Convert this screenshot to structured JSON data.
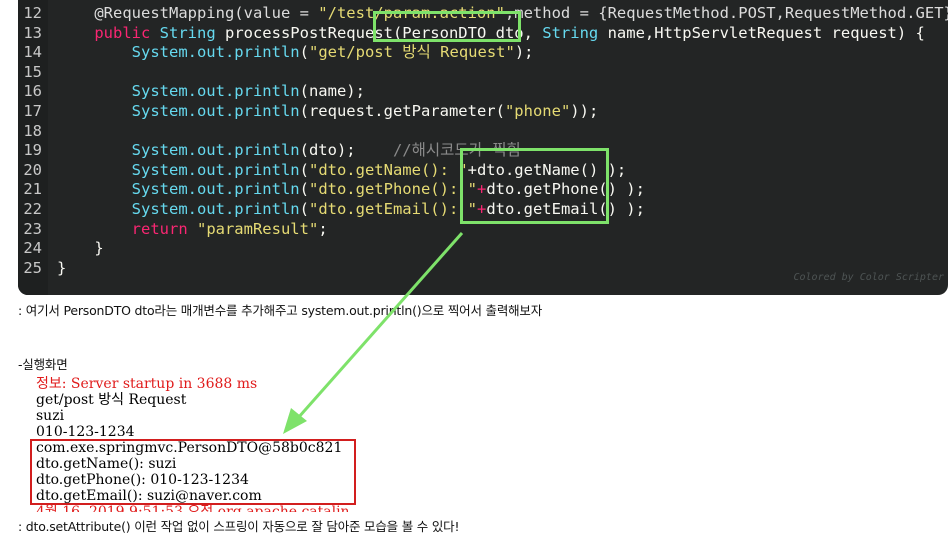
{
  "code": {
    "lines": [
      {
        "n": "12",
        "tokens": [
          [
            "ann",
            "    @RequestMapping(value = "
          ],
          [
            "str",
            "\"/test/param.action\""
          ],
          [
            "ann",
            ",method = {RequestMethod.POST,RequestMethod.GET})"
          ]
        ]
      },
      {
        "n": "13",
        "tokens": [
          [
            "kw",
            "    public "
          ],
          [
            "type",
            "String "
          ],
          [
            "plain",
            "processPostRequest(PersonDTO dto, "
          ],
          [
            "type",
            "String "
          ],
          [
            "plain",
            "name,HttpServletRequest request) {"
          ]
        ]
      },
      {
        "n": "14",
        "tokens": [
          [
            "sys",
            "        System.out.println"
          ],
          [
            "plain",
            "("
          ],
          [
            "str",
            "\"get/post 방식 Request\""
          ],
          [
            "plain",
            ");"
          ]
        ]
      },
      {
        "n": "15",
        "tokens": [
          [
            "plain",
            ""
          ]
        ]
      },
      {
        "n": "16",
        "tokens": [
          [
            "sys",
            "        System.out.println"
          ],
          [
            "plain",
            "(name);"
          ]
        ]
      },
      {
        "n": "17",
        "tokens": [
          [
            "sys",
            "        System.out.println"
          ],
          [
            "plain",
            "(request.getParameter("
          ],
          [
            "str",
            "\"phone\""
          ],
          [
            "plain",
            "));"
          ]
        ]
      },
      {
        "n": "18",
        "tokens": [
          [
            "plain",
            ""
          ]
        ]
      },
      {
        "n": "19",
        "tokens": [
          [
            "sys",
            "        System.out.println"
          ],
          [
            "plain",
            "(dto);    "
          ],
          [
            "cmt",
            "//해시코드가 찍힘"
          ]
        ]
      },
      {
        "n": "20",
        "tokens": [
          [
            "sys",
            "        System.out.println"
          ],
          [
            "plain",
            "("
          ],
          [
            "str",
            "\"dto.getName(): \""
          ],
          [
            "plain",
            "+dto.getName() );"
          ]
        ]
      },
      {
        "n": "21",
        "tokens": [
          [
            "sys",
            "        System.out.println"
          ],
          [
            "plain",
            "("
          ],
          [
            "str",
            "\"dto.getPhone(): \""
          ],
          [
            "plus",
            "+"
          ],
          [
            "plain",
            "dto.getPhone() );"
          ]
        ]
      },
      {
        "n": "22",
        "tokens": [
          [
            "sys",
            "        System.out.println"
          ],
          [
            "plain",
            "("
          ],
          [
            "str",
            "\"dto.getEmail(): \""
          ],
          [
            "plus",
            "+"
          ],
          [
            "plain",
            "dto.getEmail() );"
          ]
        ]
      },
      {
        "n": "23",
        "tokens": [
          [
            "kw",
            "        return "
          ],
          [
            "str",
            "\"paramResult\""
          ],
          [
            "plain",
            ";"
          ]
        ]
      },
      {
        "n": "24",
        "tokens": [
          [
            "plain",
            "    }"
          ]
        ]
      },
      {
        "n": "25",
        "tokens": [
          [
            "plain",
            "}"
          ]
        ]
      }
    ],
    "credit": "Colored by Color Scripter"
  },
  "text": {
    "caption1": ": 여기서 PersonDTO dto라는 매개변수를 추가해주고 system.out.println()으로 찍어서 출력해보자",
    "run_heading": "-실행화면",
    "caption2": ": dto.setAttribute() 이런 작업 없이 스프링이 자동으로 잘 담아준 모습을 볼 수 있다!"
  },
  "console": {
    "lines": [
      {
        "text": "정보: Server startup in 3688 ms",
        "color": "red"
      },
      {
        "text": "get/post 방식 Request",
        "color": "black"
      },
      {
        "text": "suzi",
        "color": "black"
      },
      {
        "text": "010-123-1234",
        "color": "black"
      },
      {
        "text": "com.exe.springmvc.PersonDTO@58b0c821",
        "color": "black"
      },
      {
        "text": "dto.getName(): suzi",
        "color": "black"
      },
      {
        "text": "dto.getPhone(): 010-123-1234",
        "color": "black"
      },
      {
        "text": "dto.getEmail(): suzi@naver.com",
        "color": "black"
      }
    ],
    "cut_line": "4월 16, 2019 9:51:53 오전 org.apache.catalin"
  },
  "colors": {
    "highlight_green": "#7ee26a",
    "highlight_red": "#d21e1e",
    "console_red": "#e01b1b",
    "code_bg": "#232525"
  }
}
